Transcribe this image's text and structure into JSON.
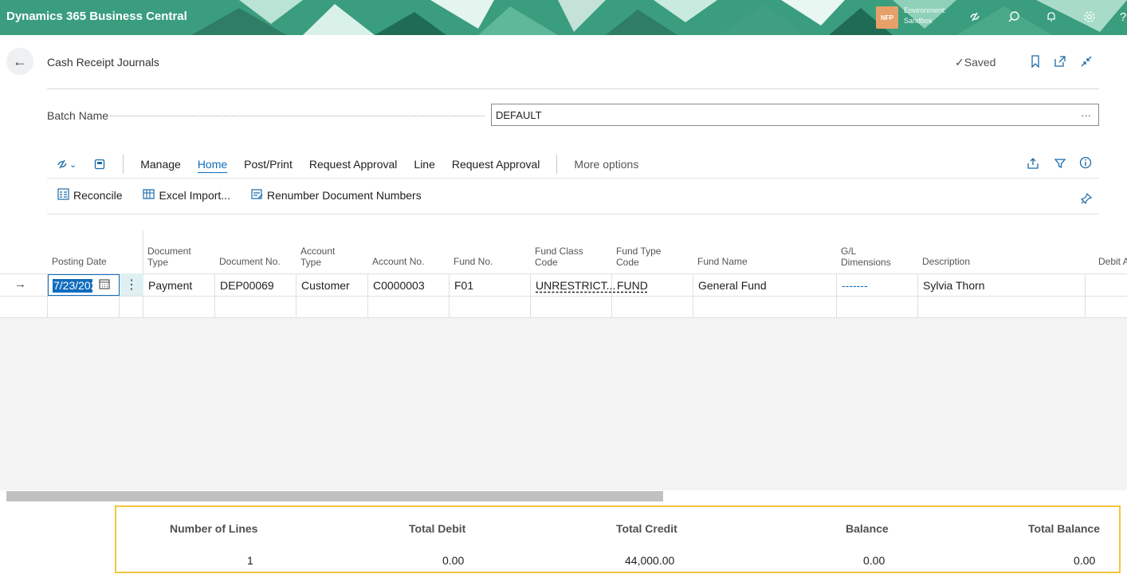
{
  "app": {
    "title": "Dynamics 365 Business Central",
    "env_badge": "NFP",
    "env_label": "Environment:",
    "env_name": "Sandbox"
  },
  "header": {
    "page_title": "Cash Receipt Journals",
    "saved_label": "Saved"
  },
  "batch": {
    "label": "Batch Name",
    "value": "DEFAULT",
    "ellipsis": "···"
  },
  "actionbar": {
    "manage": "Manage",
    "home": "Home",
    "post_print": "Post/Print",
    "request_approval_1": "Request Approval",
    "line": "Line",
    "request_approval_2": "Request Approval",
    "more_options": "More options"
  },
  "commands": {
    "reconcile": "Reconcile",
    "excel_import": "Excel Import...",
    "renumber": "Renumber Document Numbers"
  },
  "grid": {
    "columns": {
      "posting_date": "Posting Date",
      "document_type_1": "Document",
      "document_type_2": "Type",
      "document_no": "Document No.",
      "account_type_1": "Account",
      "account_type_2": "Type",
      "account_no": "Account No.",
      "fund_no": "Fund No.",
      "fund_class_1": "Fund Class",
      "fund_class_2": "Code",
      "fund_type_1": "Fund Type",
      "fund_type_2": "Code",
      "fund_name": "Fund Name",
      "gl_dim_1": "G/L",
      "gl_dim_2": "Dimensions",
      "description": "Description",
      "debit": "Debit A"
    },
    "row": {
      "posting_date": "7/23/202",
      "document_type": "Payment",
      "document_no": "DEP00069",
      "account_type": "Customer",
      "account_no": "C0000003",
      "fund_no": "F01",
      "fund_class_code": "UNRESTRICT...",
      "fund_type_code": "FUND",
      "fund_name": "General Fund",
      "gl_dimensions": "-------",
      "description": "Sylvia Thorn"
    }
  },
  "footer": {
    "number_of_lines_label": "Number of Lines",
    "number_of_lines": "1",
    "total_debit_label": "Total Debit",
    "total_debit": "0.00",
    "total_credit_label": "Total Credit",
    "total_credit": "44,000.00",
    "balance_label": "Balance",
    "balance": "0.00",
    "total_balance_label": "Total Balance",
    "total_balance": "0.00"
  },
  "colors": {
    "brand": "#3a9d7e",
    "accent": "#0f6cbd",
    "highlight": "#f2c53d"
  }
}
